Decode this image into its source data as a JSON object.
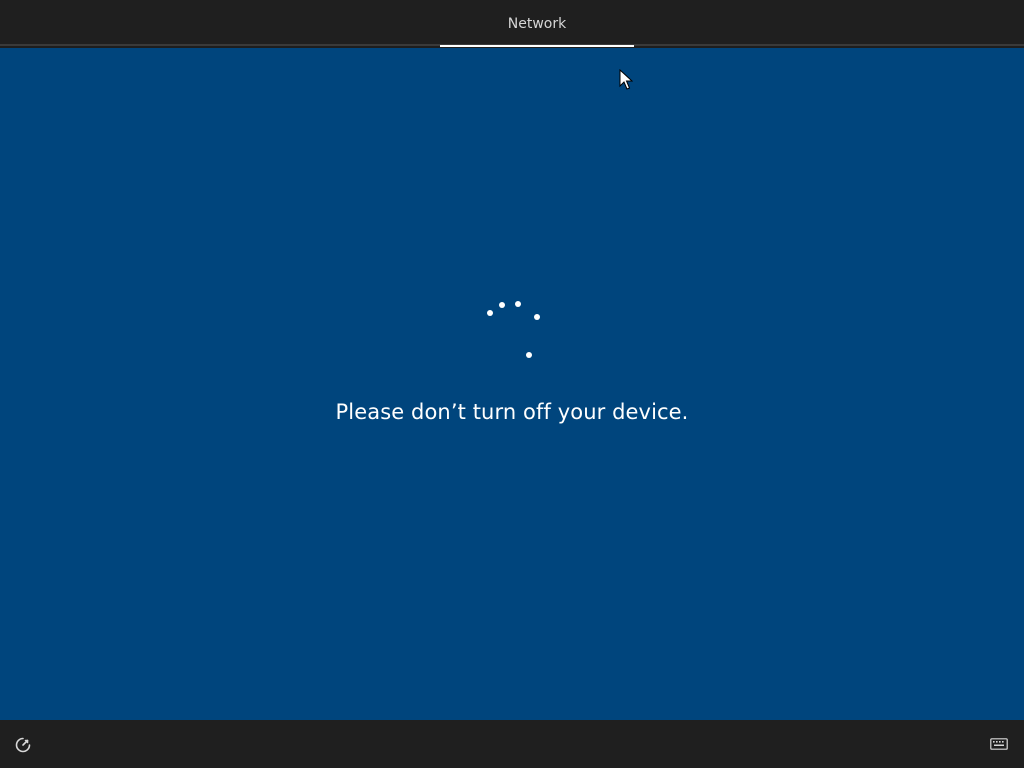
{
  "header": {
    "active_tab": "Network"
  },
  "main": {
    "message": "Please don’t turn off your device.",
    "spinner": "loading-spinner"
  },
  "footer": {
    "left_icon": "ease-of-access-icon",
    "right_icon": "keyboard-icon"
  },
  "colors": {
    "background": "#00457d",
    "bars": "#1f1f1f",
    "text": "#ffffff",
    "tab_text": "#d6d6d6"
  }
}
